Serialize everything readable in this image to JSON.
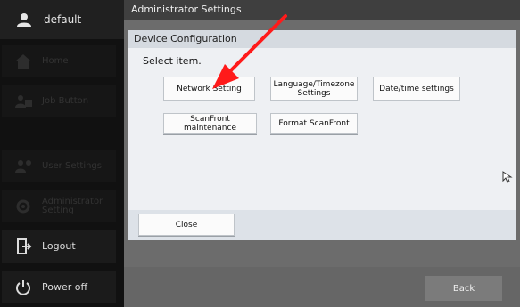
{
  "sidebar": {
    "user": "default",
    "items": [
      {
        "label": "Home",
        "icon": "home-icon",
        "enabled": false
      },
      {
        "label": "Job Button",
        "icon": "job-button-icon",
        "enabled": false
      },
      {
        "label": "User Settings",
        "icon": "user-settings-icon",
        "enabled": false
      },
      {
        "label": "Administrator Setting",
        "icon": "admin-settings-icon",
        "enabled": false
      },
      {
        "label": "Logout",
        "icon": "logout-icon",
        "enabled": true
      },
      {
        "label": "Power off",
        "icon": "power-icon",
        "enabled": true
      }
    ]
  },
  "header": {
    "title": "Administrator Settings"
  },
  "dialog": {
    "title": "Device Configuration",
    "prompt": "Select item.",
    "buttons": {
      "network": "Network Setting",
      "language": "Language/Timezone Settings",
      "datetime": "Date/time settings",
      "maintenance": "ScanFront maintenance",
      "format": "Format ScanFront"
    },
    "close": "Close"
  },
  "footer": {
    "back": "Back"
  },
  "colors": {
    "annotation_arrow": "#ff1a1a",
    "sidebar_bg": "#111111"
  }
}
